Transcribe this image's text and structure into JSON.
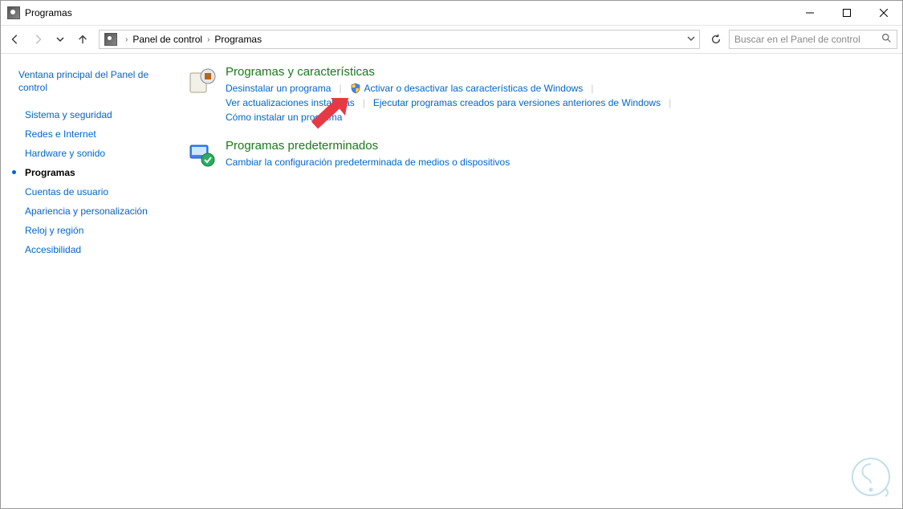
{
  "window": {
    "title": "Programas"
  },
  "breadcrumb": {
    "root": "Panel de control",
    "current": "Programas"
  },
  "search": {
    "placeholder": "Buscar en el Panel de control"
  },
  "sidebar": {
    "home": "Ventana principal del Panel de control",
    "items": [
      {
        "label": "Sistema y seguridad",
        "active": false
      },
      {
        "label": "Redes e Internet",
        "active": false
      },
      {
        "label": "Hardware y sonido",
        "active": false
      },
      {
        "label": "Programas",
        "active": true
      },
      {
        "label": "Cuentas de usuario",
        "active": false
      },
      {
        "label": "Apariencia y personalización",
        "active": false
      },
      {
        "label": "Reloj y región",
        "active": false
      },
      {
        "label": "Accesibilidad",
        "active": false
      }
    ]
  },
  "sections": {
    "programs": {
      "title": "Programas y características",
      "links": {
        "uninstall": "Desinstalar un programa",
        "features": "Activar o desactivar las características de Windows",
        "updates": "Ver actualizaciones instaladas",
        "compat": "Ejecutar programas creados para versiones anteriores de Windows",
        "howto": "Cómo instalar un programa"
      }
    },
    "defaults": {
      "title": "Programas predeterminados",
      "links": {
        "change": "Cambiar la configuración predeterminada de medios o dispositivos"
      }
    }
  }
}
